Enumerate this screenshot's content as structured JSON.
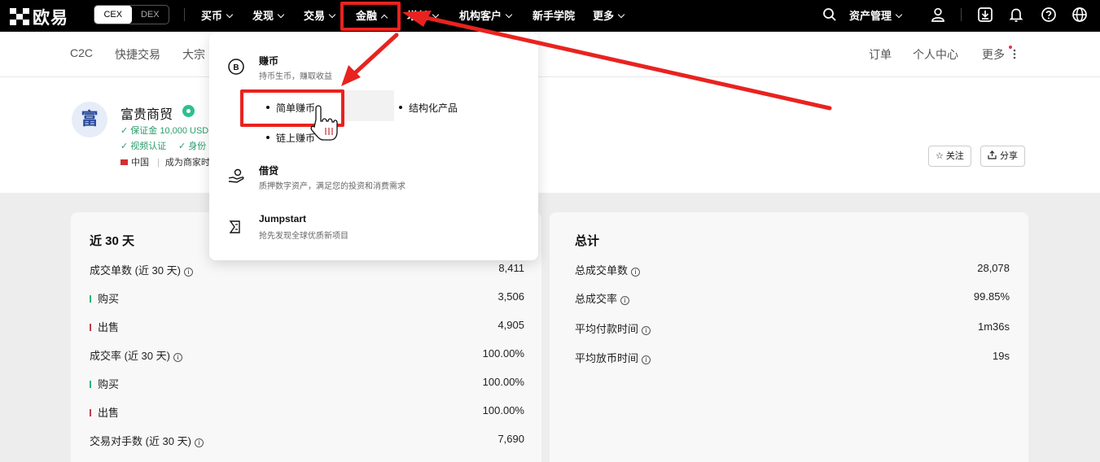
{
  "brand": {
    "name": "欧易"
  },
  "mode_toggle": {
    "cex": "CEX",
    "dex": "DEX"
  },
  "top_nav": [
    {
      "label": "买币",
      "chevron": "down"
    },
    {
      "label": "发现",
      "chevron": "down"
    },
    {
      "label": "交易",
      "chevron": "down"
    },
    {
      "label": "金融",
      "chevron": "up"
    },
    {
      "label": "增长",
      "chevron": "down"
    },
    {
      "label": "机构客户",
      "chevron": "down"
    },
    {
      "label": "新手学院",
      "chevron": "none"
    },
    {
      "label": "更多",
      "chevron": "down"
    }
  ],
  "top_right": {
    "search_icon": "search-icon",
    "assets": "资产管理",
    "icons": [
      "user-icon",
      "download-icon",
      "bell-icon",
      "help-icon",
      "globe-icon"
    ]
  },
  "sub_nav": {
    "left": [
      "C2C",
      "快捷交易",
      "大宗"
    ],
    "right": [
      "订单",
      "个人中心",
      "更多"
    ]
  },
  "merchant": {
    "avatar_char": "富",
    "name": "富贵商贸",
    "deposit": "✓ 保证金 10,000 USD",
    "video_verified": "✓ 视频认证",
    "id_verified": "✓ 身份",
    "country": "中国",
    "merchant_since": "成为商家时",
    "follow_label": "☆ 关注",
    "share_label": "分享"
  },
  "dropdown": {
    "earn": {
      "title": "赚币",
      "desc": "持币生币，赚取收益",
      "subs": [
        "简单赚币",
        "结构化产品",
        "链上赚币"
      ]
    },
    "loan": {
      "title": "借贷",
      "desc": "质押数字资产，满足您的投资和消费需求"
    },
    "jumpstart": {
      "title": "Jumpstart",
      "desc": "抢先发现全球优质新项目"
    }
  },
  "stats_30d": {
    "title": "近 30 天",
    "rows": [
      {
        "label": "成交单数 (近 30 天)",
        "value": "8,411",
        "info": true
      },
      {
        "label": "购买",
        "value": "3,506",
        "marker": "green"
      },
      {
        "label": "出售",
        "value": "4,905",
        "marker": "red"
      },
      {
        "label": "成交率 (近 30 天)",
        "value": "100.00%",
        "info": true
      },
      {
        "label": "购买",
        "value": "100.00%",
        "marker": "green"
      },
      {
        "label": "出售",
        "value": "100.00%",
        "marker": "red"
      },
      {
        "label": "交易对手数 (近 30 天)",
        "value": "7,690",
        "info": true
      }
    ]
  },
  "stats_total": {
    "title": "总计",
    "rows": [
      {
        "label": "总成交单数",
        "value": "28,078",
        "info": true
      },
      {
        "label": "总成交率",
        "value": "99.85%",
        "info": true
      },
      {
        "label": "平均付款时间",
        "value": "1m36s",
        "info": true
      },
      {
        "label": "平均放币时间",
        "value": "19s",
        "info": true
      }
    ]
  },
  "annotation_colors": {
    "highlight": "#e8231f"
  }
}
